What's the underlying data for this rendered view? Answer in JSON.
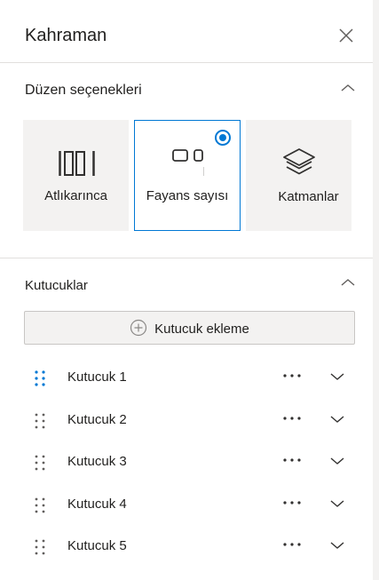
{
  "panel": {
    "title": "Kahraman"
  },
  "layout_section": {
    "title": "Düzen seçenekleri",
    "options": [
      {
        "label": "Atlıkarınca",
        "icon": "carousel-icon",
        "selected": false
      },
      {
        "label": "Fayans sayısı",
        "icon": "tiles-icon",
        "selected": true
      },
      {
        "label": "Katmanlar",
        "icon": "layers-icon",
        "selected": false
      }
    ]
  },
  "tiles_section": {
    "title": "Kutucuklar",
    "add_label": "Kutucuk ekleme",
    "items": [
      {
        "label": "Kutucuk 1"
      },
      {
        "label": "Kutucuk 2"
      },
      {
        "label": "Kutucuk 3"
      },
      {
        "label": "Kutucuk 4"
      },
      {
        "label": "Kutucuk 5"
      }
    ]
  },
  "colors": {
    "accent": "#0078d4",
    "option_bg": "#f3f2f1",
    "border": "#e1dfdd",
    "text": "#201f1e"
  }
}
